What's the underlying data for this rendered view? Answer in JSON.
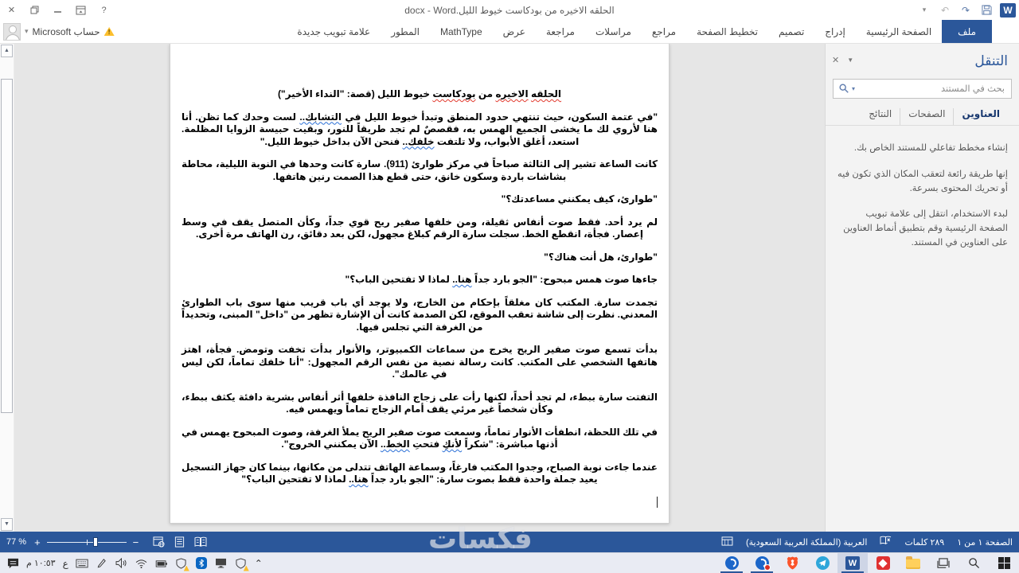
{
  "title_bar": {
    "title": "الحلقه الاخيره من بودكاست خيوط الليل.docx - Word",
    "help_label": "?",
    "close_glyph": "✕",
    "customize_glyph": "▾",
    "undo_glyph": "↶",
    "redo_glyph": "↷",
    "word_logo_letter": "W"
  },
  "ribbon": {
    "file_tab": "ملف",
    "tabs": [
      "الصفحة الرئيسية",
      "إدراج",
      "تصميم",
      "تخطيط الصفحة",
      "مراجع",
      "مراسلات",
      "مراجعة",
      "عرض",
      "MathType",
      "المطور",
      "علامة تبويب جديدة"
    ],
    "account_label": "حساب Microsoft",
    "account_dropdown_glyph": "▾",
    "warning_glyph": "!"
  },
  "navigation_pane": {
    "title": "التنقل",
    "close_glyph": "✕",
    "options_glyph": "▼",
    "search_placeholder": "بحث في المستند",
    "search_dropdown_glyph": "▾",
    "tabs": [
      {
        "label": "العناوين",
        "active": true
      },
      {
        "label": "الصفحات",
        "active": false
      },
      {
        "label": "النتائج",
        "active": false
      }
    ],
    "body": [
      "إنشاء مخطط تفاعلي للمستند الخاص بك.",
      "إنها طريقة رائعة لتعقب المكان الذي تكون فيه أو تحريك المحتوى بسرعة.",
      "لبدء الاستخدام، انتقل إلى علامة تبويب الصفحة الرئيسية وقم بتطبيق أنماط العناوين على العناوين في المستند."
    ]
  },
  "document": {
    "heading": {
      "align": "c",
      "runs": [
        {
          "t": "الحلقه",
          "m": "red"
        },
        {
          "t": " "
        },
        {
          "t": "الاخيره",
          "m": "red"
        },
        {
          "t": " من "
        },
        {
          "t": "بودكاست",
          "m": "red"
        },
        {
          "t": " خيوط الليل (قصة: \"النداء الأخير\")"
        }
      ]
    },
    "paragraphs": [
      {
        "align": "j",
        "runs": [
          {
            "t": "\"في عتمة السكون، حيث تنتهي حدود المنطق وتبدأ خيوط الليل في "
          },
          {
            "t": "التشابك..",
            "m": "blue"
          },
          {
            "t": " لست وحدك كما تظن. أنا هنا لأروي لك ما يخشى الجميع الهمس به، فقصصٌ لم تجد طريقاً للنور، وبقيت حبيسة الزوايا المظلمة. استعد، أغلق الأبواب، ولا تلتفت "
          },
          {
            "t": "خلفك..",
            "m": "blue"
          },
          {
            "t": " فنحن الآن بداخل خيوط الليل.\""
          }
        ]
      },
      {
        "align": "j",
        "runs": [
          {
            "t": "كانت الساعة تشير إلى الثالثة صباحاً في مركز طوارئ (911). سارة كانت وحدها في النوبة الليلية، محاطة بشاشات باردة وسكون خانق، حتى قطع هذا الصمت رنين هاتفها."
          }
        ]
      },
      {
        "align": "r",
        "runs": [
          {
            "t": "\"طوارئ، كيف يمكنني مساعدتك؟\""
          }
        ]
      },
      {
        "align": "j",
        "runs": [
          {
            "t": "لم يرد أحد. فقط صوت أنفاس ثقيلة، ومن خلفها صفير ريح قوي جداً، وكأن المتصل يقف في وسط إعصار. فجأة، انقطع الخط. سجلت سارة الرقم كبلاغ مجهول، لكن بعد دقائق، رن الهاتف مرة أخرى."
          }
        ]
      },
      {
        "align": "r",
        "runs": [
          {
            "t": "\"طوارئ، هل أنت هناك؟\""
          }
        ]
      },
      {
        "align": "r",
        "runs": [
          {
            "t": "جاءها صوت همس مبحوح: \"الجو بارد جداً "
          },
          {
            "t": "هنا..",
            "m": "blue"
          },
          {
            "t": " لماذا لا تفتحين الباب؟\""
          }
        ]
      },
      {
        "align": "j",
        "runs": [
          {
            "t": "تجمدت سارة. المكتب كان مغلقاً بإحكام من الخارج، ولا يوجد أي باب قريب منها سوى باب الطوارئ المعدني. نظرت إلى شاشة تعقب الموقع، لكن الصدمة كانت أن الإشارة تظهر من \"داخل\" المبنى، وتحديداً من الغرفة التي تجلس فيها."
          }
        ]
      },
      {
        "align": "j",
        "runs": [
          {
            "t": "بدأت تسمع صوت صفير الريح يخرج من سماعات الكمبيوتر، والأنوار بدأت تخفت وتومض. فجأة، اهتز هاتفها الشخصي على المكتب. كانت رسالة نصية من نفس الرقم المجهول: \"أنا خلفك تماماً، لكن ليس في عالمك\"."
          }
        ]
      },
      {
        "align": "j",
        "runs": [
          {
            "t": "التفتت سارة ببطء، لم تجد أحداً، لكنها رأت على زجاج النافذة خلفها أثر أنفاس بشرية دافئة يكثف ببطء، وكأن شخصاً غير مرئي يقف أمام الزجاج تماماً ويهمس فيه."
          }
        ]
      },
      {
        "align": "j",
        "runs": [
          {
            "t": "في تلك اللحظة، انطفأت الأنوار تماماً، وسمعت صوت صفير الريح يملأ الغرفة، وصوت المبحوح يهمس في أذنها مباشرة: \"شكراً "
          },
          {
            "t": "لأنكِ",
            "m": "blue"
          },
          {
            "t": " فتحتِ "
          },
          {
            "t": "الخط..",
            "m": "blue"
          },
          {
            "t": " الآن يمكنني الخروج\"."
          }
        ]
      },
      {
        "align": "j",
        "runs": [
          {
            "t": "عندما جاءت نوبة الصباح، وجدوا المكتب فارغاً، وسماعة الهاتف تتدلى من مكانها، بينما كان جهاز التسجيل يعيد جملة واحدة فقط بصوت سارة: \"الجو بارد جداً "
          },
          {
            "t": "هنا..",
            "m": "blue"
          },
          {
            "t": " لماذا لا تفتحين الباب؟\""
          }
        ]
      }
    ]
  },
  "status_bar": {
    "page_indicator": "الصفحة ١ من ١",
    "word_count": "٢٨٩ كلمات",
    "language": "العربية (المملكة العربية السعودية)",
    "zoom_level": "77 %",
    "zoom_in_glyph": "+",
    "zoom_out_glyph": "−"
  },
  "taskbar": {
    "time": "١٠:٥٣ م",
    "input_language": "ع",
    "hidden_icons_glyph": "⌃",
    "tray_icons": [
      "action-center",
      "clock",
      "input-language",
      "touch-keyboard",
      "pen",
      "volume",
      "wifi",
      "battery",
      "shield-warning",
      "bluetooth",
      "monitor",
      "shield-warning",
      "hidden-icons-chevron"
    ],
    "app_icons": [
      "blue-circular-app",
      "blue-circular-app-badge",
      "brave",
      "telegram",
      "word-active",
      "red-diamond-app",
      "file-explorer",
      "task-view",
      "search",
      "windows-start"
    ]
  },
  "watermark": "فكسات",
  "colors": {
    "word_blue": "#2b579a",
    "canvas_gray": "#e6e6e6",
    "spell_red": "#e23a2e",
    "grammar_blue": "#2a6fd6",
    "taskbar_bg": "#e9ebf3"
  }
}
